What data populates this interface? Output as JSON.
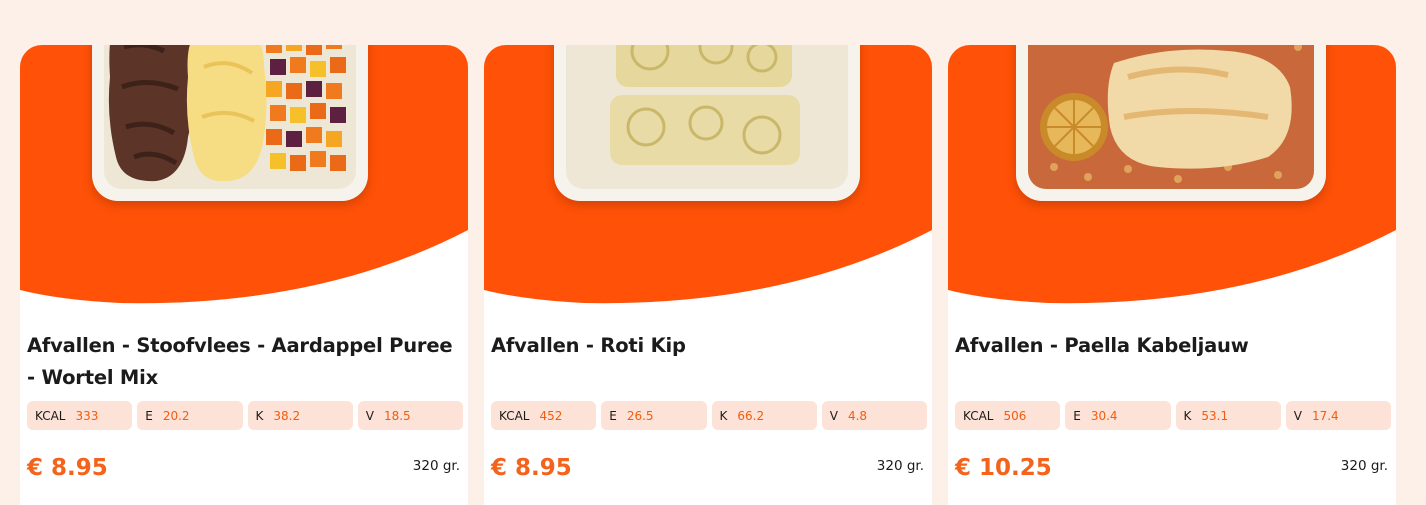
{
  "theme": {
    "accent": "#FF5107",
    "background": "#FDF0E8",
    "chip": "#FDE2D7"
  },
  "products": [
    {
      "title": "Afvallen - Stoofvlees - Aardappel Puree - Wortel Mix",
      "image_icon": "meal-stoofvlees-image",
      "macros": [
        {
          "key": "KCAL",
          "value": "333"
        },
        {
          "key": "E",
          "value": "20.2"
        },
        {
          "key": "K",
          "value": "38.2"
        },
        {
          "key": "V",
          "value": "18.5"
        }
      ],
      "price": "€ 8.95",
      "weight": "320 gr."
    },
    {
      "title": "Afvallen - Roti Kip",
      "image_icon": "meal-roti-kip-image",
      "macros": [
        {
          "key": "KCAL",
          "value": "452"
        },
        {
          "key": "E",
          "value": "26.5"
        },
        {
          "key": "K",
          "value": "66.2"
        },
        {
          "key": "V",
          "value": "4.8"
        }
      ],
      "price": "€ 8.95",
      "weight": "320 gr."
    },
    {
      "title": "Afvallen - Paella Kabeljauw",
      "image_icon": "meal-paella-image",
      "macros": [
        {
          "key": "KCAL",
          "value": "506"
        },
        {
          "key": "E",
          "value": "30.4"
        },
        {
          "key": "K",
          "value": "53.1"
        },
        {
          "key": "V",
          "value": "17.4"
        }
      ],
      "price": "€ 10.25",
      "weight": "320 gr."
    }
  ]
}
